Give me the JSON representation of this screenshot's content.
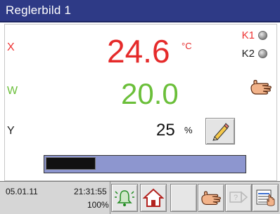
{
  "window": {
    "title": "Reglerbild 1"
  },
  "controller": {
    "x": {
      "label": "X",
      "value": "24.6",
      "unit": "°C"
    },
    "w": {
      "label": "W",
      "value": "20.0"
    },
    "y": {
      "label": "Y",
      "value": "25",
      "unit": "%",
      "percent": 25
    }
  },
  "outputs": [
    {
      "label": "K1"
    },
    {
      "label": "K2"
    }
  ],
  "status": {
    "date": "05.01.11",
    "time": "21:31:55",
    "zoom": "100%"
  },
  "colors": {
    "title_bar": "#2e3a86",
    "actual_value": "#e52a2a",
    "setpoint": "#6bbf3a",
    "bar_background": "#8d96cf"
  },
  "icons": [
    "bell-icon",
    "home-icon",
    "hand-icon",
    "help-icon",
    "menu-icon",
    "pencil-icon"
  ]
}
